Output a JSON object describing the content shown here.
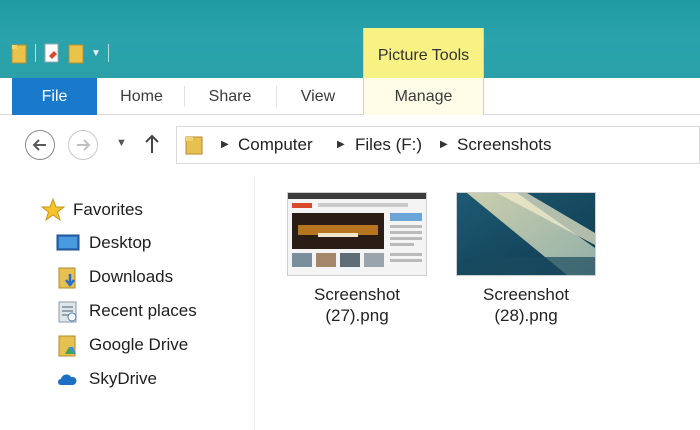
{
  "ribbon": {
    "context_group": "Picture Tools",
    "tabs": {
      "file": "File",
      "home": "Home",
      "share": "Share",
      "view": "View",
      "manage": "Manage"
    }
  },
  "address_bar": {
    "crumbs": [
      "Computer",
      "Files (F:)",
      "Screenshots"
    ]
  },
  "nav_pane": {
    "favorites": "Favorites",
    "items": [
      {
        "label": "Desktop",
        "icon": "desktop-icon"
      },
      {
        "label": "Downloads",
        "icon": "downloads-icon"
      },
      {
        "label": "Recent places",
        "icon": "recent-places-icon"
      },
      {
        "label": "Google Drive",
        "icon": "google-drive-icon"
      },
      {
        "label": "SkyDrive",
        "icon": "skydrive-icon"
      }
    ]
  },
  "files": [
    {
      "name_line1": "Screenshot",
      "name_line2": "(27).png"
    },
    {
      "name_line1": "Screenshot",
      "name_line2": "(28).png"
    }
  ],
  "colors": {
    "titlebar": "#2aa3ac",
    "file_tab": "#1979ca",
    "picture_tools": "#f7f283"
  }
}
